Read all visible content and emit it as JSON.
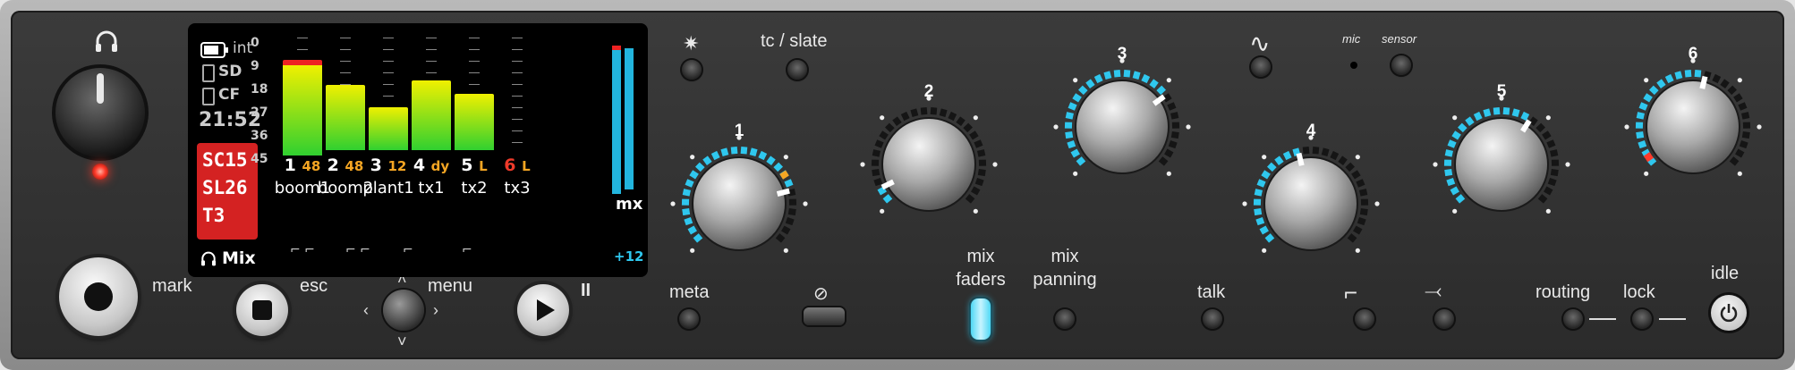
{
  "colors": {
    "accent": "#2fc7ee",
    "led_red": "#ff3a2a",
    "meter_top": "#f0f000",
    "meter_bottom": "#30d030",
    "take_box": "#d42222",
    "gain_orange": "#f5a623"
  },
  "headphone": {
    "icon": "headphone-icon"
  },
  "buttons": {
    "mark": "mark",
    "esc": "esc",
    "menu": "menu",
    "meta": "meta",
    "mix_faders": "mix\nfaders",
    "mix_panning": "mix\npanning",
    "talk": "talk",
    "routing": "routing",
    "lock": "lock",
    "idle": "idle",
    "tc_slate": "tc / slate",
    "mic": "mic",
    "sensor": "sensor"
  },
  "display": {
    "power_source": "int",
    "media_sd": "SD",
    "media_cf": "CF",
    "time": "21:52",
    "scene": "SC15",
    "slate": "SL26",
    "take": "T3",
    "mode": "Mix",
    "mx_label": "mx",
    "mx_gain": "+12",
    "scale": [
      "0",
      "9",
      "18",
      "27",
      "36",
      "45"
    ],
    "channels": [
      {
        "num": "1",
        "setting": "48",
        "name": "boom1",
        "level": 0.9,
        "peak": true
      },
      {
        "num": "2",
        "setting": "48",
        "name": "boom2",
        "level": 0.65,
        "peak": false
      },
      {
        "num": "3",
        "setting": "12",
        "name": "plant1",
        "level": 0.43,
        "peak": false
      },
      {
        "num": "4",
        "setting": "dy",
        "name": "tx1",
        "level": 0.7,
        "peak": false
      },
      {
        "num": "5",
        "setting": "L",
        "name": "tx2",
        "level": 0.56,
        "peak": false
      },
      {
        "num": "6",
        "setting": "L",
        "name": "tx3",
        "level": 0,
        "peak": false
      }
    ],
    "mix_levels": [
      0.95,
      0.93
    ]
  },
  "knobs": [
    {
      "label": "1",
      "gain": 0.78,
      "pan_marker": true
    },
    {
      "label": "2",
      "gain": 0.07,
      "pan_marker": false
    },
    {
      "label": "3",
      "gain": 0.7,
      "pan_marker": false
    },
    {
      "label": "4",
      "gain": 0.45,
      "pan_marker": false
    },
    {
      "label": "5",
      "gain": 0.62,
      "pan_marker": false
    },
    {
      "label": "6",
      "gain": 0.55,
      "pan_marker": false
    }
  ]
}
